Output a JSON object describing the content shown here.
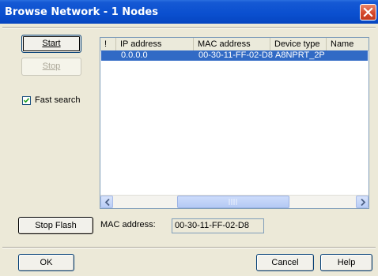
{
  "window": {
    "title": "Browse Network - 1 Nodes"
  },
  "buttons": {
    "start": "Start",
    "stop": "Stop",
    "stop_flash": "Stop Flash",
    "ok": "OK",
    "cancel": "Cancel",
    "help": "Help"
  },
  "fast_search": {
    "label": "Fast search",
    "checked": true
  },
  "table": {
    "columns": [
      "!",
      "IP address",
      "MAC address",
      "Device type",
      "Name"
    ],
    "rows": [
      {
        "flag": "",
        "ip": "0.0.0.0",
        "mac": "00-30-11-FF-02-D8",
        "device_type": "A8NPRT_2P",
        "name": ""
      }
    ],
    "selected_row": 0
  },
  "mac_address": {
    "label": "MAC address:",
    "value": "00-30-11-FF-02-D8"
  },
  "colors": {
    "title_bar": "#0a4fcf",
    "selection": "#316ac5",
    "dialog_bg": "#ece9d8"
  }
}
